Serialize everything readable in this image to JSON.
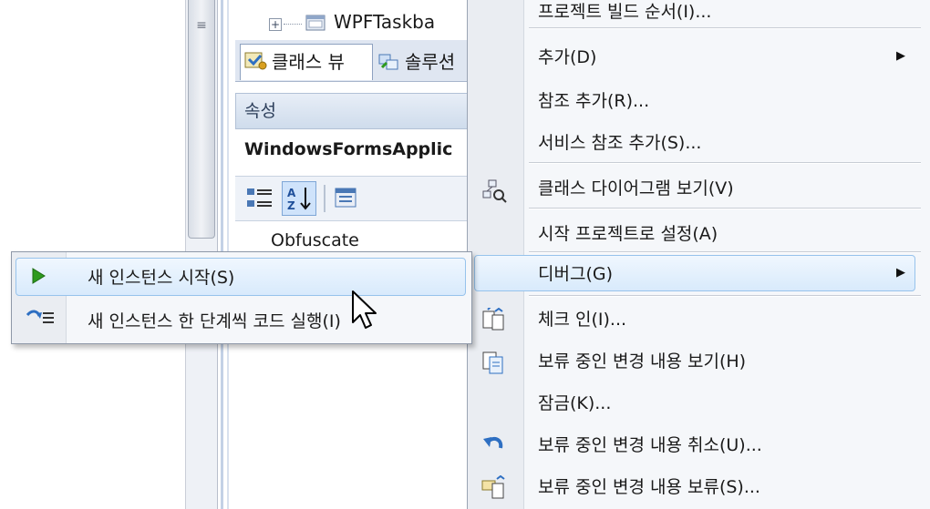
{
  "solution_explorer": {
    "tree_node_label": "WPFTaskba",
    "tree_expander": "+"
  },
  "tabs": {
    "class_view": "클래스 뷰",
    "solution": "솔루션"
  },
  "properties": {
    "header": "속성",
    "object_name": "WindowsFormsApplic",
    "row_label": "Obfuscate"
  },
  "context_menu": {
    "items": [
      {
        "label": "프로젝트 빌드 순서(I)...",
        "icon": "none"
      },
      {
        "label": "추가(D)",
        "icon": "none",
        "has_submenu": true
      },
      {
        "label": "참조 추가(R)...",
        "icon": "none"
      },
      {
        "label": "서비스 참조 추가(S)...",
        "icon": "none"
      },
      {
        "label": "클래스 다이어그램 보기(V)",
        "icon": "class-diagram-icon"
      },
      {
        "label": "시작 프로젝트로 설정(A)",
        "icon": "none"
      },
      {
        "label": "디버그(G)",
        "icon": "none",
        "has_submenu": true,
        "highlighted": true
      },
      {
        "label": "체크 인(I)...",
        "icon": "check-in-icon"
      },
      {
        "label": "보류 중인 변경 내용 보기(H)",
        "icon": "pending-changes-icon"
      },
      {
        "label": "잠금(K)...",
        "icon": "none"
      },
      {
        "label": "보류 중인 변경 내용 취소(U)...",
        "icon": "undo-icon"
      },
      {
        "label": "보류 중인 변경 내용 보류(S)...",
        "icon": "shelve-icon"
      }
    ]
  },
  "debug_submenu": {
    "items": [
      {
        "label": "새 인스턴스 시작(S)",
        "icon": "play-icon",
        "highlighted": true
      },
      {
        "label": "새 인스턴스 한 단계씩 코드 실행(I)",
        "icon": "step-into-icon"
      }
    ]
  },
  "colors": {
    "highlight_border": "#97c3ec",
    "highlight_fill": "#d8eafc",
    "play_green": "#2e9a1e"
  }
}
